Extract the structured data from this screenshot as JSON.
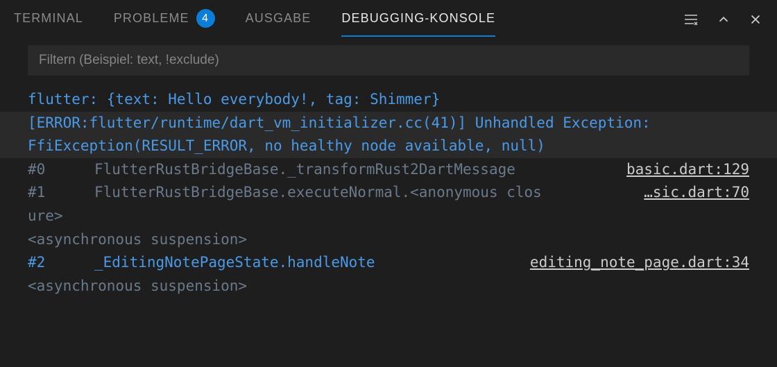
{
  "tabs": {
    "terminal": "TERMINAL",
    "probleme": "PROBLEME",
    "probleme_badge": "4",
    "ausgabe": "AUSGABE",
    "debugging": "DEBUGGING-KONSOLE"
  },
  "filter": {
    "placeholder": "Filtern (Beispiel: text, !exclude)"
  },
  "output": {
    "line1": "flutter: {text: Hello everybody!, tag: Shimmer}",
    "line2a": "[ERROR:flutter/runtime/dart_vm_initializer.cc(41)] Unhandled Exception:",
    "line2b": "FfiException(RESULT_ERROR, no healthy node available, null)",
    "frame0_num": "#0",
    "frame0_method": "FlutterRustBridgeBase._transformRust2DartMessage",
    "frame0_loc": "basic.dart:129",
    "frame1_num": "#1",
    "frame1_method": "FlutterRustBridgeBase.executeNormal.<anonymous clos",
    "frame1_loc": "…sic.dart:70",
    "frame1_cont": "ure>",
    "async_susp": "<asynchronous suspension>",
    "frame2_num": "#2",
    "frame2_method": "_EditingNotePageState.handleNote",
    "frame2_loc": "editing_note_page.dart:34"
  }
}
